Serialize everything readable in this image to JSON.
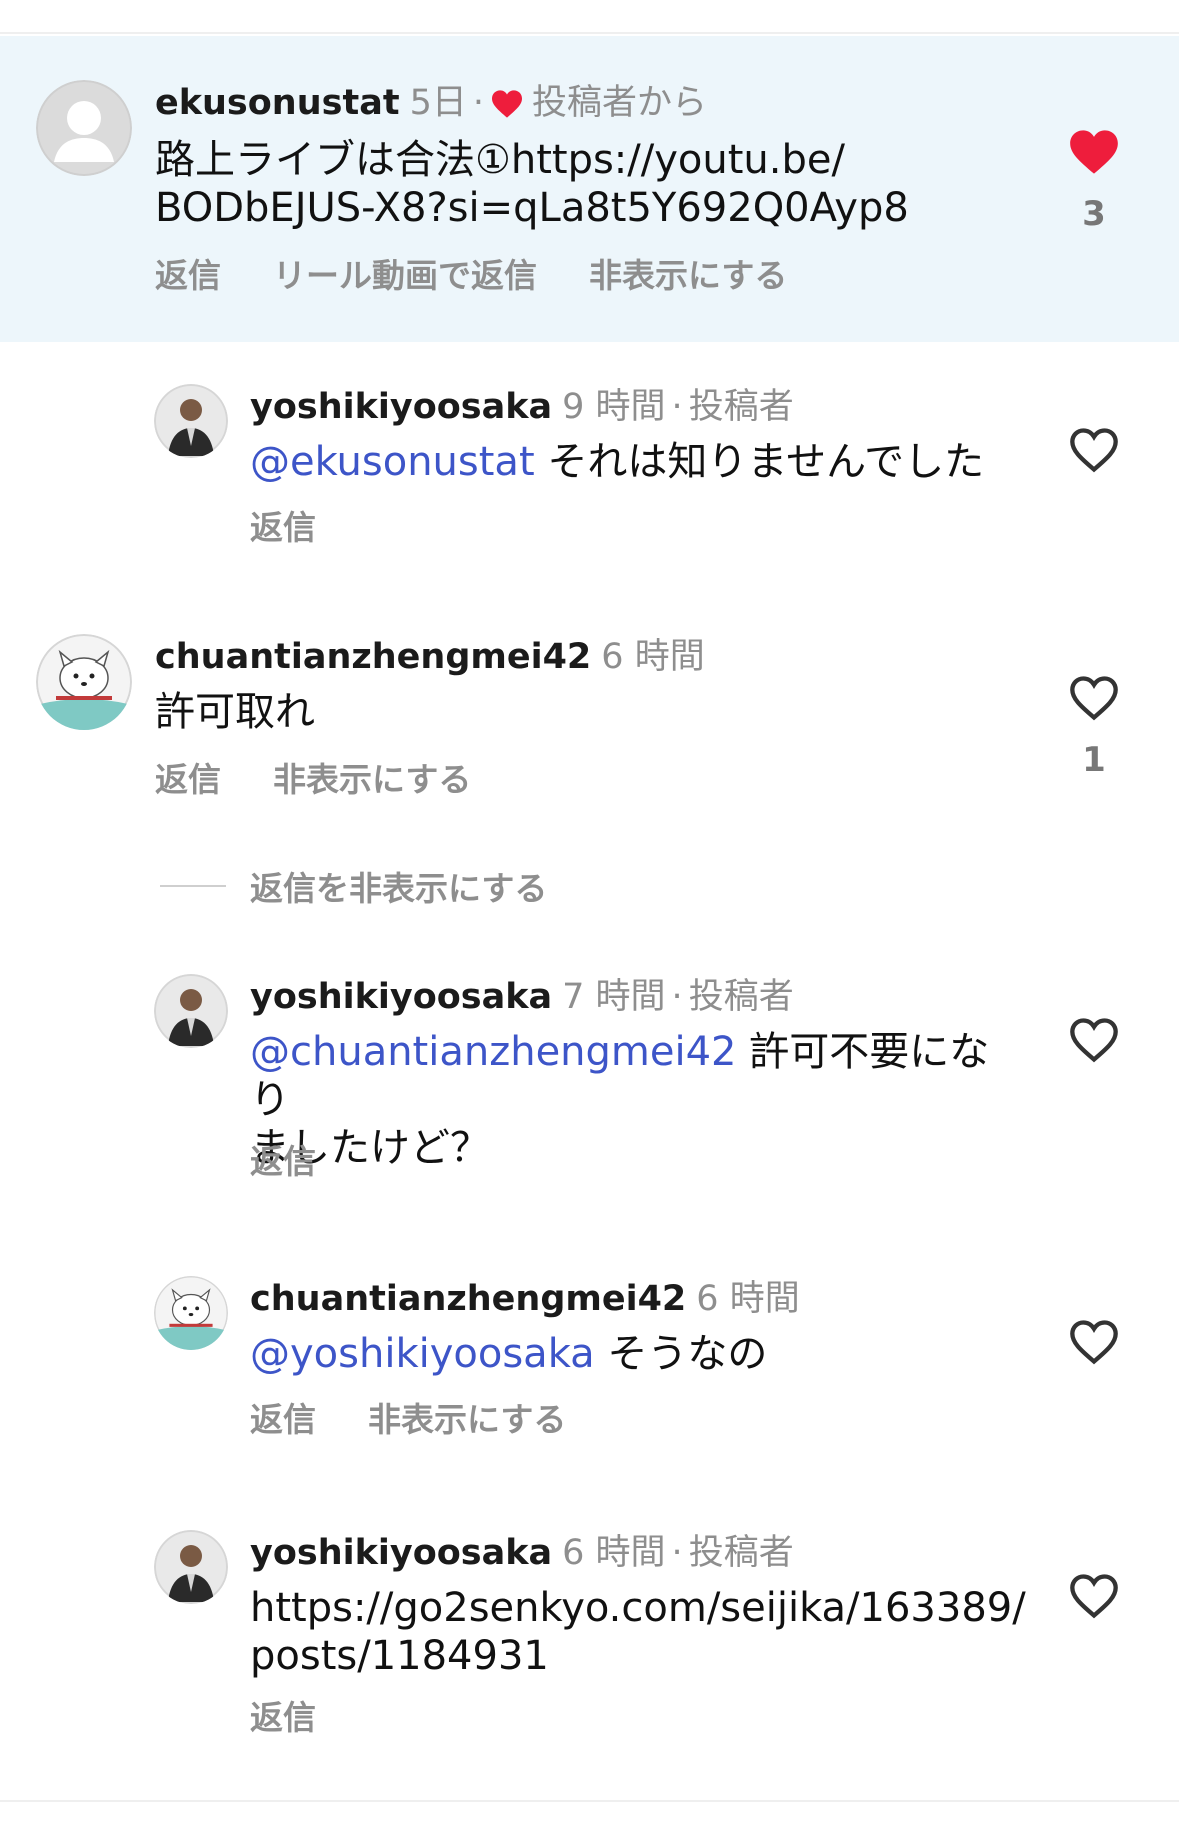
{
  "comments": [
    {
      "username": "ekusonustat",
      "time": "5日",
      "sep": "·",
      "from_author_label": "投稿者から",
      "text_line1": "路上ライブは合法①https://youtu.be/",
      "text_line2": "BODbEJUS-X8?si=qLa8t5Y692Q0Ayp8",
      "reply": "返信",
      "reel_reply": "リール動画で返信",
      "hide": "非表示にする",
      "like_count": "3"
    },
    {
      "username": "yoshikiyoosaka",
      "time": "9 時間",
      "sep": "·",
      "badge": "投稿者",
      "mention": "@ekusonustat",
      "text": "それは知りませんでした",
      "reply": "返信"
    },
    {
      "username": "chuantianzhengmei42",
      "time": "6 時間",
      "text": "許可取れ",
      "reply": "返信",
      "hide": "非表示にする",
      "like_count": "1"
    },
    {
      "username": "yoshikiyoosaka",
      "time": "7 時間",
      "sep": "·",
      "badge": "投稿者",
      "mention": "@chuantianzhengmei42",
      "text_line1": "許可不要になり",
      "text_line2": "ましたけど？",
      "reply": "返信"
    },
    {
      "username": "chuantianzhengmei42",
      "time": "6 時間",
      "mention": "@yoshikiyoosaka",
      "text": "そうなの",
      "reply": "返信",
      "hide": "非表示にする"
    },
    {
      "username": "yoshikiyoosaka",
      "time": "6 時間",
      "sep": "·",
      "badge": "投稿者",
      "text_line1": "https://go2senkyo.com/seijika/163389/",
      "text_line2": "posts/1184931",
      "reply": "返信"
    }
  ],
  "hide_replies_label": "返信を非表示にする",
  "colors": {
    "liked_heart": "#ee1d3c",
    "mention": "#3d55c8",
    "secondary_text": "#8e8e8e",
    "highlight_bg": "#edf6fb"
  },
  "icons": [
    "heart-filled-icon",
    "heart-outline-icon",
    "default-avatar-icon"
  ]
}
